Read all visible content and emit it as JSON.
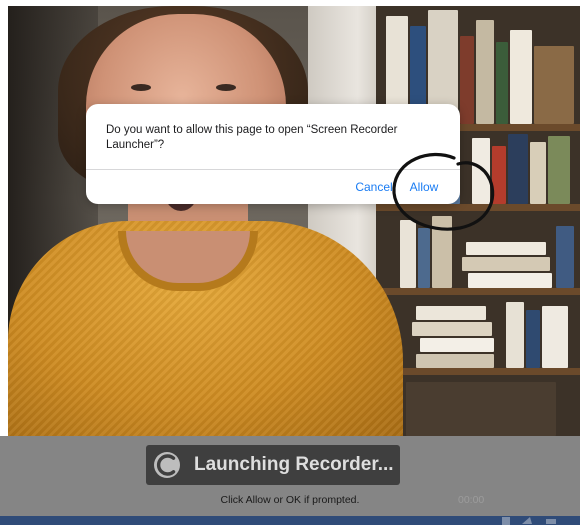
{
  "dialog": {
    "message": "Do you want to allow this page to open “Screen Recorder Launcher”?",
    "cancel_label": "Cancel",
    "allow_label": "Allow"
  },
  "launcher": {
    "status_label": "Launching Recorder...",
    "hint": "Click Allow or OK if prompted.",
    "timer": "00:00"
  },
  "colors": {
    "dialog_button": "#1a7cf3",
    "overlay": "#858585",
    "badge": "#3f3f3f",
    "bottom_strip": "#2f4b78"
  },
  "icons": {
    "spinner": "loading-spinner-icon",
    "annotation": "hand-drawn-circle"
  }
}
